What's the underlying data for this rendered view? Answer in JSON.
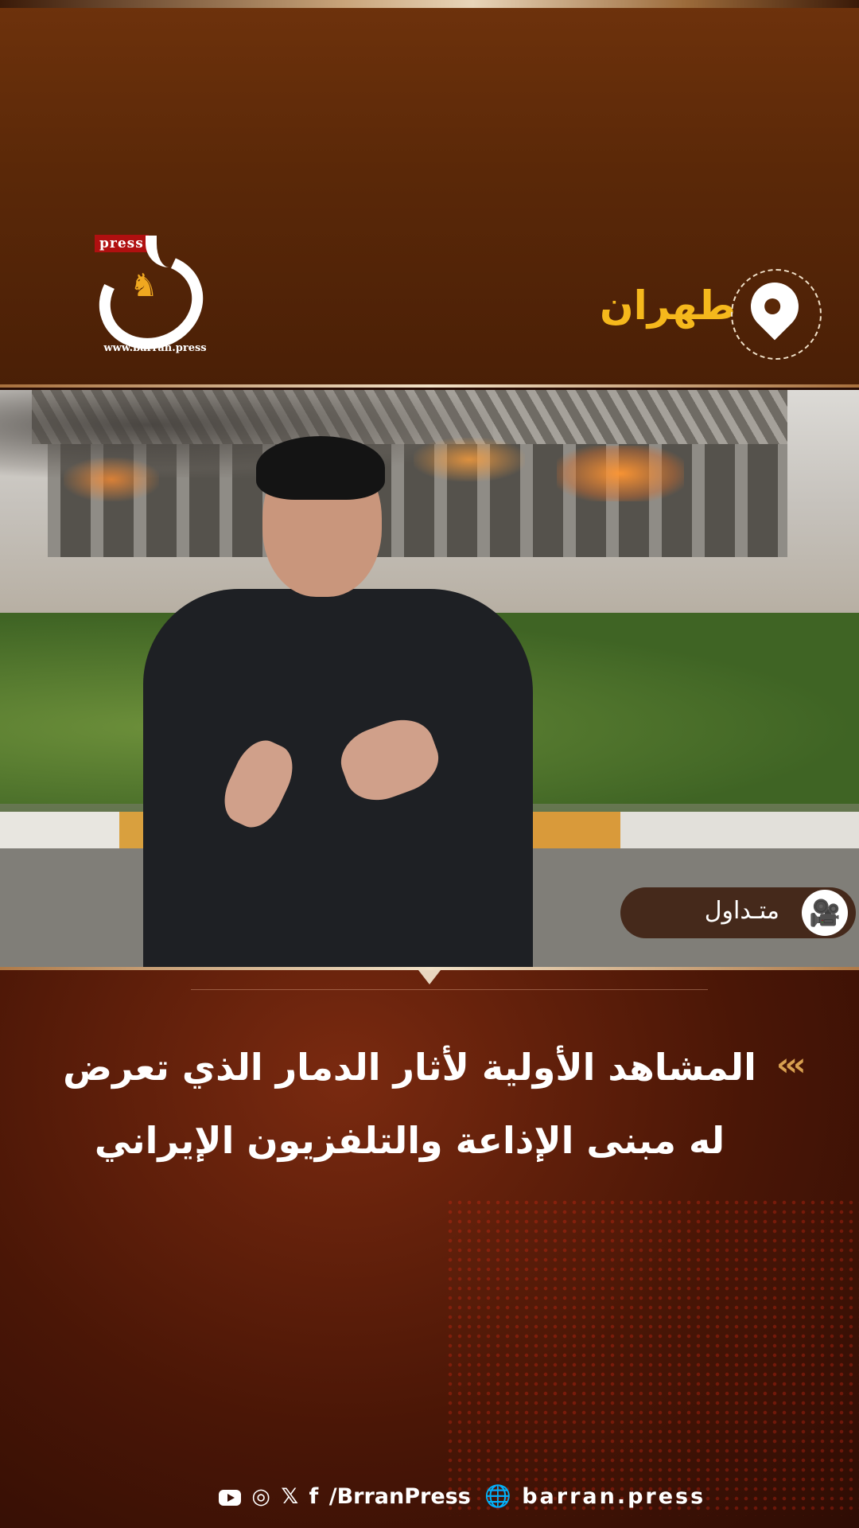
{
  "header": {
    "logo_tag": "press",
    "logo_url": "www.barran.press",
    "location": "طهران"
  },
  "video": {
    "badge_label": "متـداول"
  },
  "headline": {
    "line1": "المشاهد الأولية لأثار الدمار الذي تعرض",
    "line2": "له مبنى الإذاعة والتلفزيون الإيراني"
  },
  "footer": {
    "handle": "/BrranPress",
    "website": "barran.press"
  },
  "colors": {
    "accent_gold": "#f5b81c",
    "background_brown": "#5a2808",
    "logo_red": "#b01010"
  },
  "icons": [
    "location-pin-icon",
    "video-camera-icon",
    "youtube-icon",
    "instagram-icon",
    "x-icon",
    "facebook-icon",
    "globe-icon",
    "chevrons-icon"
  ]
}
